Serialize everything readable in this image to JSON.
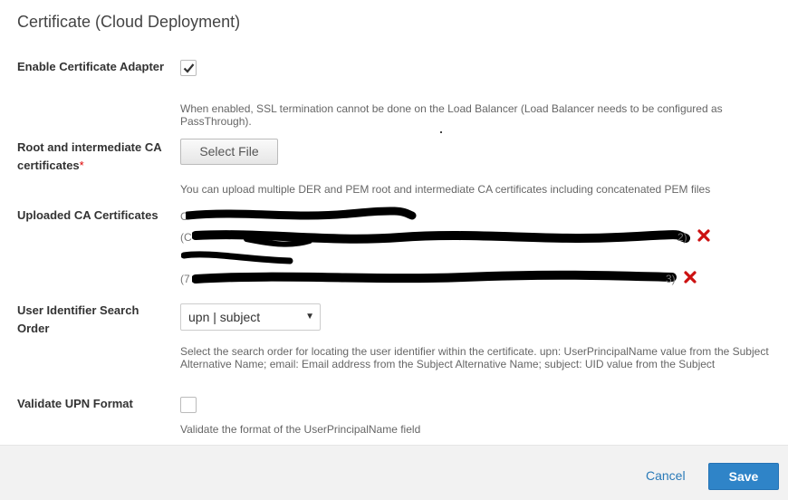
{
  "page": {
    "title": "Certificate (Cloud Deployment)"
  },
  "enable_adapter": {
    "label": "Enable Certificate Adapter",
    "checked": true,
    "help": "When enabled, SSL termination cannot be done on the Load Balancer (Load Balancer needs to be configured as PassThrough)."
  },
  "root_ca": {
    "label": "Root and intermediate CA certificates",
    "required_mark": "*",
    "button_label": "Select File",
    "help": "You can upload multiple DER and PEM root and intermediate CA certificates including concatenated PEM files"
  },
  "uploaded": {
    "label": "Uploaded CA Certificates",
    "items": [
      {
        "name": "C",
        "detail": "(C",
        "detail_end": "2)"
      },
      {
        "name": "",
        "detail": "(7",
        "detail_end": "3)"
      }
    ]
  },
  "search_order": {
    "label": "User Identifier Search Order",
    "selected": "upn | subject",
    "help": "Select the search order for locating the user identifier within the certificate. upn: UserPrincipalName value from the Subject Alternative Name; email: Email address from the Subject Alternative Name; subject: UID value from the Subject"
  },
  "validate_upn": {
    "label": "Validate UPN Format",
    "checked": false,
    "help": "Validate the format of the UserPrincipalName field"
  },
  "footer": {
    "cancel_label": "Cancel",
    "save_label": "Save"
  },
  "colors": {
    "primary": "#2f84c8",
    "link": "#2a7ab8",
    "remove": "#cc1111",
    "redaction": "#000000"
  }
}
